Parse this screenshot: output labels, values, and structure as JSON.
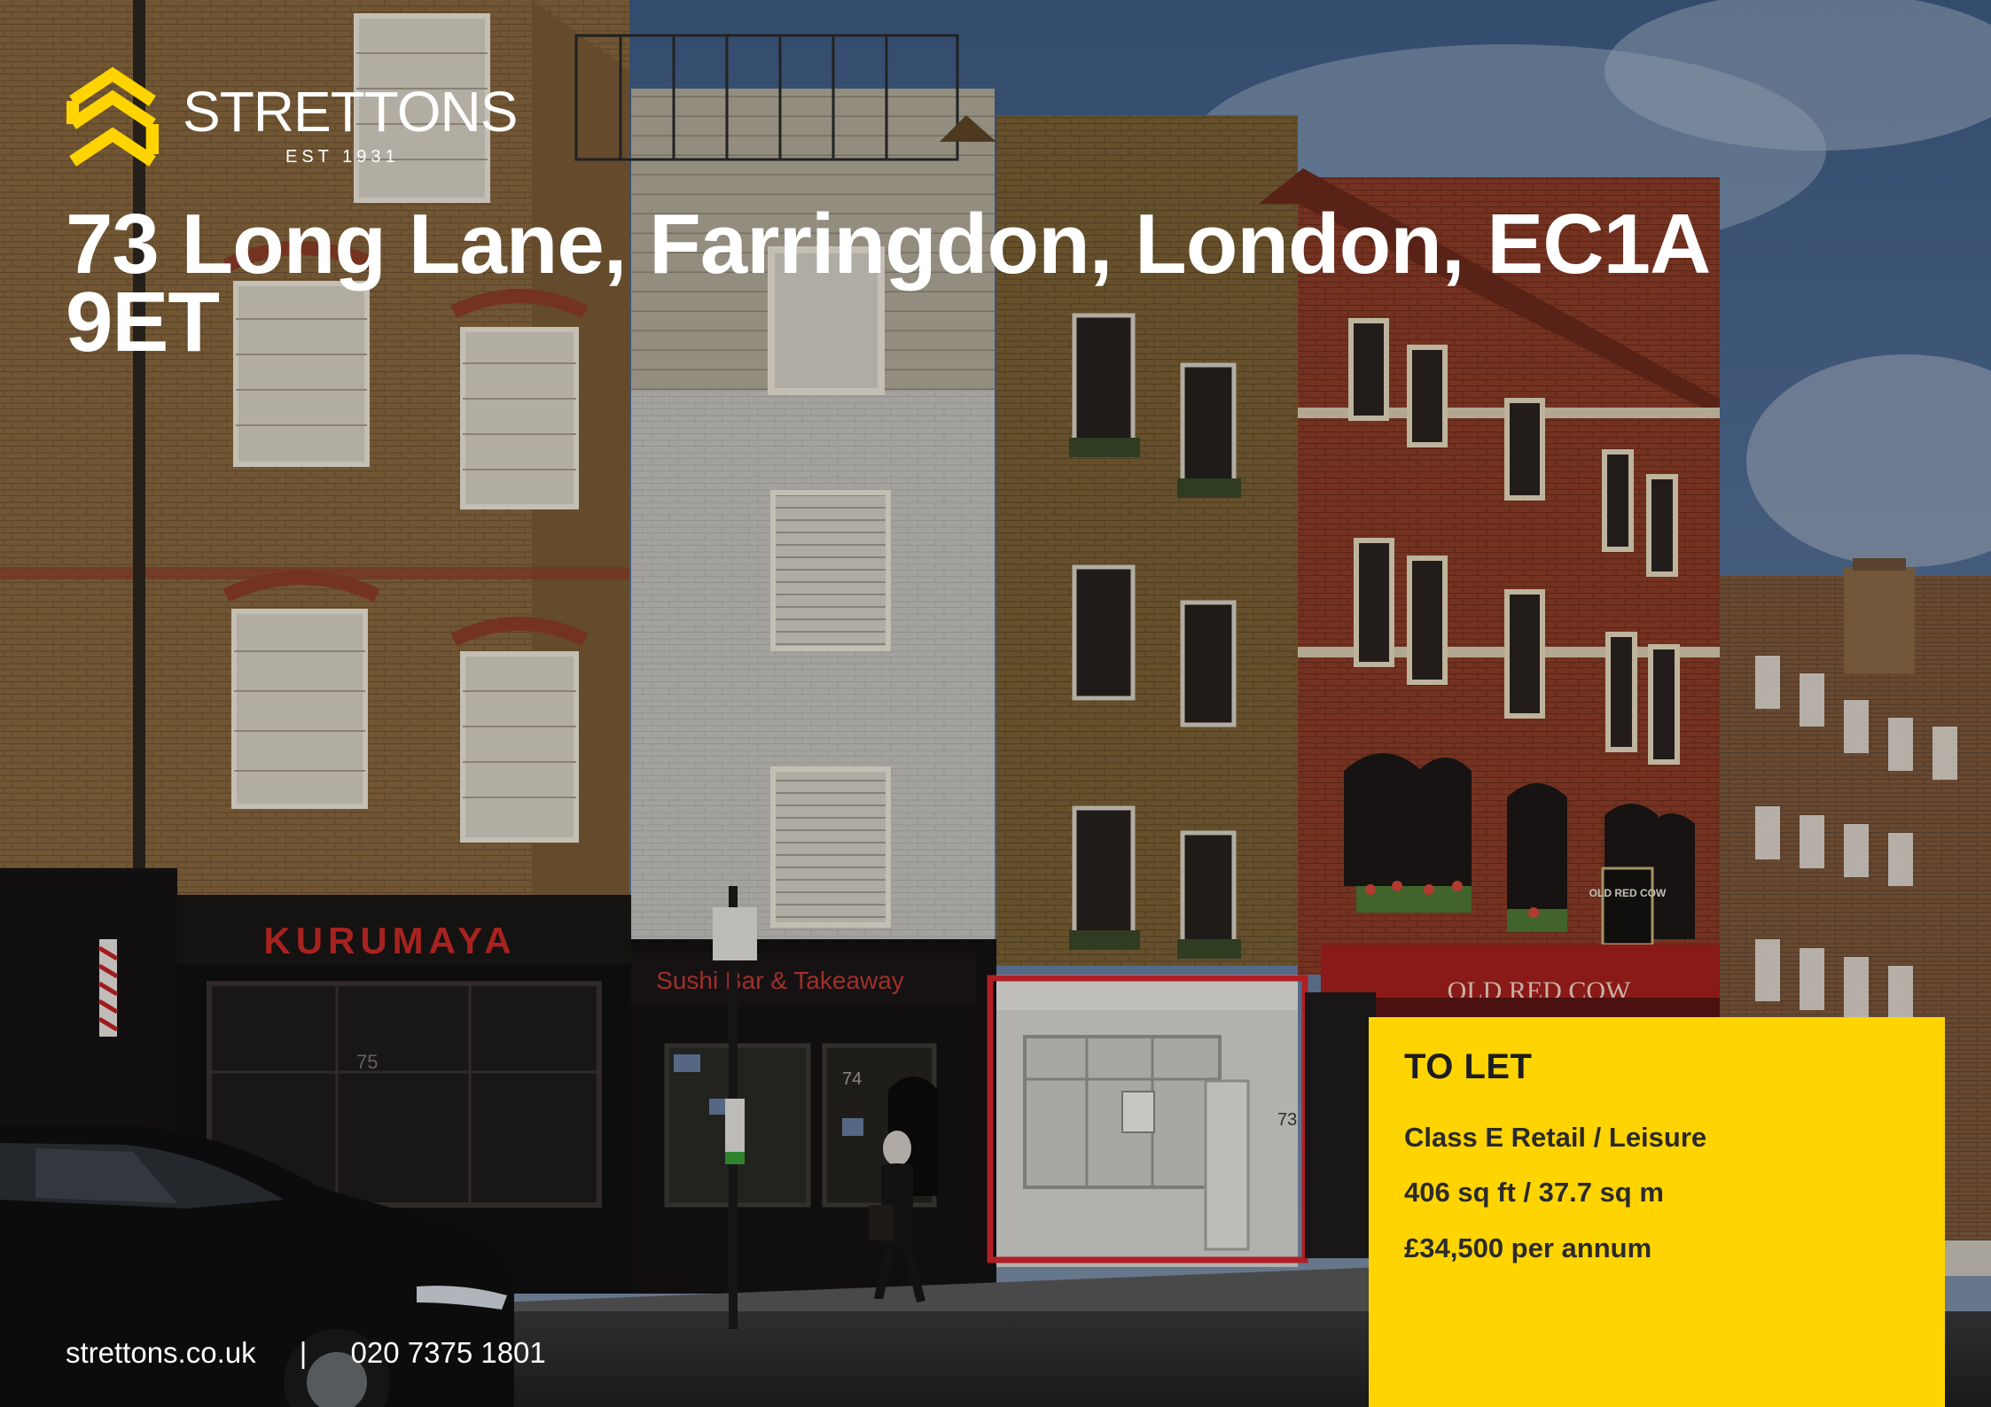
{
  "brand": {
    "name": "STRETTONS",
    "established": "EST 1931",
    "accent_color": "#ffd400"
  },
  "property": {
    "address": "73 Long Lane, Farringdon, London, EC1A 9ET"
  },
  "listing": {
    "status": "TO LET",
    "use_class": "Class E Retail / Leisure",
    "size": "406 sq ft / 37.7 sq m",
    "price": "£34,500 per annum"
  },
  "contact": {
    "website": "strettons.co.uk",
    "separator": "|",
    "phone": "020 7375 1801"
  },
  "photo": {
    "shop_signs": {
      "kurumaya": "KURUMAYA",
      "sushi": "Sushi Bar & Takeaway",
      "old_red_cow": "OLD RED COW",
      "pub_board": "OLD RED COW"
    },
    "door_numbers": {
      "n75": "75",
      "n74": "74",
      "n73": "73"
    },
    "highlight_color": "#d6262d"
  }
}
